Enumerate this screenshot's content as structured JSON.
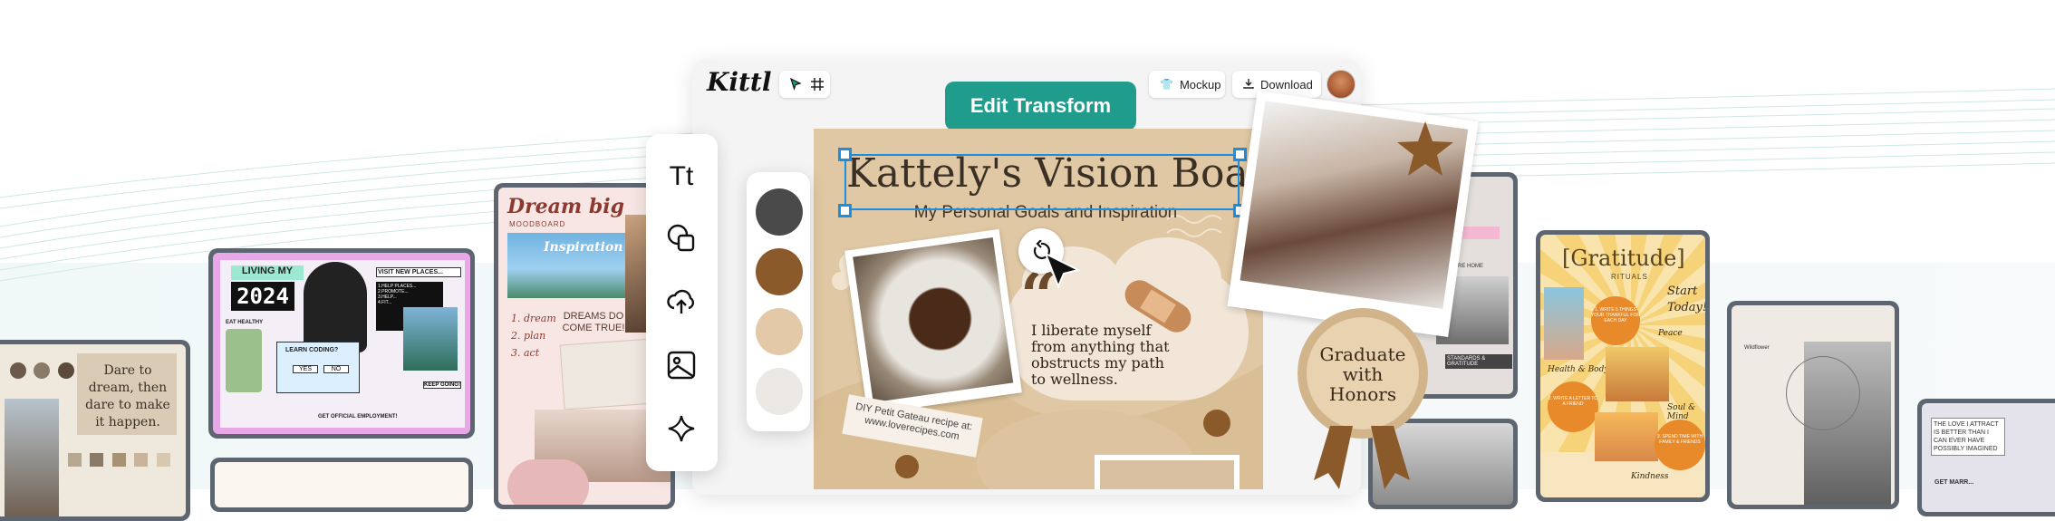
{
  "app": {
    "logo": "Kittl"
  },
  "header": {
    "mockup_label": "Mockup",
    "download_label": "Download",
    "edit_transform_label": "Edit Transform"
  },
  "board": {
    "title": "Kattely's Vision Board",
    "subtitle": "My Personal Goals and Inspiration",
    "quote": "I liberate myself from anything that obstructs my path to wellness.",
    "quote_mark": "“",
    "recipe_note": "DIY Petit Gateau recipe at: www.loverecipes.com",
    "badge_text": "Graduate with Honors"
  },
  "palette": {
    "colors": [
      "#4a4a4a",
      "#8b5a2b",
      "#e3c9a8",
      "#ece8e4"
    ]
  },
  "toolbar": {
    "items": [
      "text-tool",
      "shapes-tool",
      "upload-tool",
      "image-tool",
      "ai-tool"
    ],
    "text_label": "Tt"
  },
  "side_cards": {
    "dream_card": {
      "text": "Dare to dream, then dare to make it happen."
    },
    "living_card": {
      "title_top": "LIVING MY",
      "year": "2024",
      "visit": "VISIT NEW PLACES...",
      "list": "1.HELP PLACES...\n2.PROMOTE...\n3.HELP...\n4.FIT...",
      "eat": "EAT HEALTHY",
      "coding": "LEARN CODING?",
      "yes": "YES",
      "no": "NO",
      "keep": "KEEP GOING!",
      "employment": "GET OFFICIAL EMPLOYMENT!"
    },
    "dreambig_card": {
      "title": "Dream big",
      "subtitle": "MOODBOARD",
      "inspiration": "Inspiration",
      "list": [
        "1. dream",
        "2. plan",
        "3. act"
      ],
      "dreams_do": "DREAMS DO COME TRUE!"
    },
    "gratitude_card": {
      "title": "[Gratitude]",
      "subtitle": "RITUALS",
      "start_today": "Start Today!",
      "peace": "Peace",
      "health": "Health & Body",
      "soul": "Soul & Mind",
      "kindness": "Kindness",
      "note1": "1. WRITE 5 THINGS YOUR THANKFUL FOR EACH DAY",
      "note2": "2. WRITE A LETTER TO A FRIEND",
      "note3": "3. SPEND TIME WITH FAMILY & FRIENDS"
    },
    "right_card": {
      "label": "Wildflower",
      "quote": "THE LOVE I ATTRACT IS BETTER THAN I CAN EVER HAVE POSSIBLY IMAGINED",
      "quote2": "GET MARR..."
    },
    "mid_card": {
      "text1": "DESIRE HOME",
      "text2": "STANDARDS & GRATITUDE"
    }
  }
}
